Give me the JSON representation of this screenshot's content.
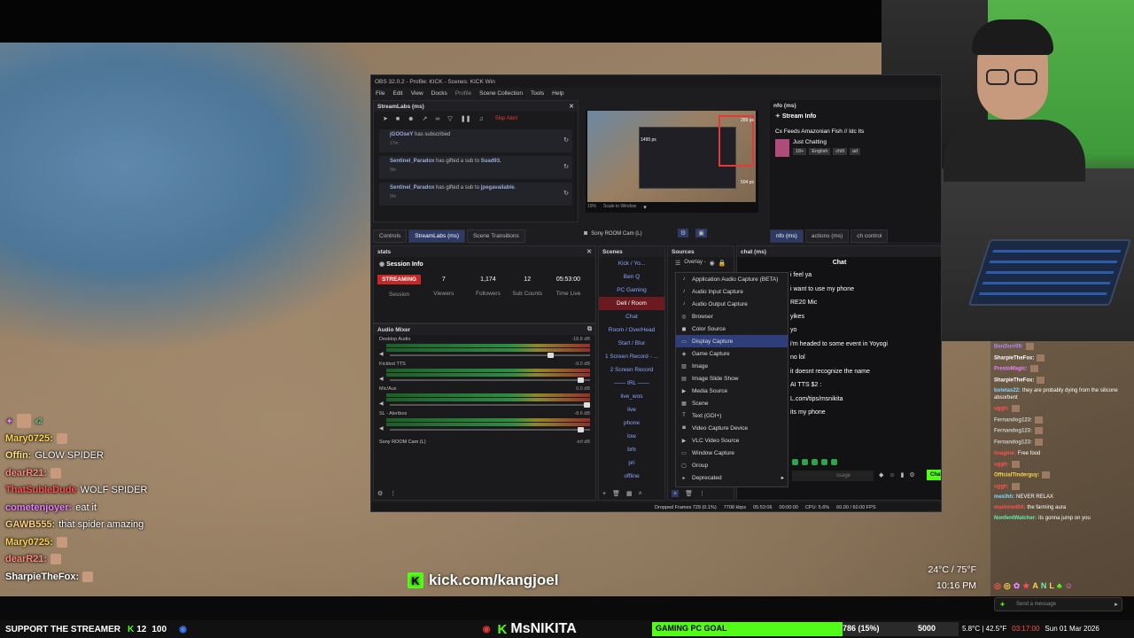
{
  "obs": {
    "title": "OBS 32.0.2 - Profile: KICK - Scenes: KICK Win",
    "menu": [
      "File",
      "Edit",
      "View",
      "Docks",
      "Profile",
      "Scene Collection",
      "Tools",
      "Help"
    ],
    "streamlabs_panel": {
      "title": "StreamLabs (ms)",
      "skip_alert": "Skip Alert",
      "alerts": [
        {
          "user": "jGOOseY",
          "text": "has subscribed",
          "time": "17m"
        },
        {
          "user": "Sentinel_Paradox",
          "text": "has gifted a sub to",
          "target": "Suad93.",
          "time": "5hr"
        },
        {
          "user": "Sentinel_Paradox",
          "text": "has gifted a sub to",
          "target": "jpegavailable.",
          "time": "5hr"
        }
      ]
    },
    "preview": {
      "zoom": "19%",
      "scale": "Scale to Window",
      "dim1": "1495 px",
      "dim2": "289 px",
      "dim3": "504 px"
    },
    "dock_tabs": [
      "Controls",
      "StreamLabs (ms)",
      "Scene Transitions"
    ],
    "source_cam": "Sony ROOM Cam (L)",
    "info_panel": {
      "title": "nfo (ms)",
      "stream_info": "Stream Info",
      "stream_title": "Cx Feeds Amazonian Fish // Idc Its",
      "category": "Just Chatting",
      "tags": [
        "18+",
        "English",
        "chill",
        "ad"
      ],
      "tabs": [
        "nfo (ms)",
        "actions (ms)",
        "ch control"
      ]
    },
    "stats": {
      "panel": "stats",
      "section": "Session Info",
      "status": "STREAMING",
      "session_label": "Session",
      "viewers": "7",
      "viewers_label": "Viewers",
      "followers": "1,174",
      "followers_label": "Followers",
      "subs": "12",
      "subs_label": "Sub Counts",
      "time": "05:53:00",
      "time_label": "Time Live"
    },
    "mixer": {
      "title": "Audio Mixer",
      "tracks": [
        {
          "name": "Desktop Audio",
          "db": "-18.8 dB",
          "fader": 0.82
        },
        {
          "name": "Kickbot TTS",
          "db": "-9.0 dB",
          "fader": 0.97
        },
        {
          "name": "Mic/Aux",
          "db": "0.0 dB",
          "fader": 1.0
        },
        {
          "name": "SL - Alertbox",
          "db": "-8.6 dB",
          "fader": 0.97
        }
      ],
      "last": "Sony ROOM Cam (L)",
      "last_db": "-inf dB",
      "scale": "-60 -55 -50 -45 -40 -35 -30 -25 -20 -15 -10 -5 0"
    },
    "scenes": {
      "title": "Scenes",
      "items": [
        "Kick / Yo...",
        "Ben Q",
        "PC Gaming",
        "Dell / Room",
        "Chat",
        "Room / OverHead",
        "Start / Blur",
        "1 Screen Record - ...",
        "2 Screen Record",
        "—— IRL ——",
        "live_wos",
        "live",
        "phone",
        "low",
        "brb",
        "pri",
        "offline"
      ],
      "active": "Dell / Room"
    },
    "sources": {
      "title": "Sources",
      "overlay": "Overlay -"
    },
    "add_menu": {
      "items": [
        "Application Audio Capture (BETA)",
        "Audio Input Capture",
        "Audio Output Capture",
        "Browser",
        "Color Source",
        "Display Capture",
        "Game Capture",
        "Image",
        "Image Slide Show",
        "Media Source",
        "Scene",
        "Text (GDI+)",
        "Video Capture Device",
        "VLC Video Source",
        "Window Capture",
        "Group",
        "Deprecated"
      ],
      "highlighted": "Display Capture"
    },
    "chat_dock": {
      "title": "chat (ms)",
      "header": "Chat",
      "lines": [
        "i feel ya",
        "i want to use my phone",
        "RE20 Mic",
        "yikes",
        "yo",
        "i'm headed to some event in Yoyogi",
        "no lol",
        "it doesnt recognize the name",
        "AI TTS $2 :",
        "L.com/tips/msnikita",
        "its my phone"
      ],
      "input_placeholder": "ssage",
      "send": "Chat"
    },
    "statusbar": {
      "dropped": "Dropped Frames 729 (0.1%)",
      "kbps": "7708 kbps",
      "time": "05:53:06",
      "rec": "00:00:00",
      "cpu": "CPU: 5.6%",
      "fps": "60.00 / 60.00 FPS"
    }
  },
  "overlay_chat": [
    {
      "user": "Mary0725:",
      "color": "#ffd54a",
      "msg": ""
    },
    {
      "user": "Offin:",
      "color": "#ffe082",
      "msg": "GLOW SPIDER"
    },
    {
      "user": "dearR21:",
      "color": "#ff8a80",
      "msg": ""
    },
    {
      "user": "ThatSubleDude",
      "color": "#ff5252",
      "msg": "WOLF SPIDER"
    },
    {
      "user": "cometenjoyer:",
      "color": "#ea80fc",
      "msg": "eat it"
    },
    {
      "user": "GAWB555:",
      "color": "#ffd180",
      "msg": "that spider amazing"
    },
    {
      "user": "Mary0725:",
      "color": "#ffd54a",
      "msg": ""
    },
    {
      "user": "dearR21:",
      "color": "#ff8a80",
      "msg": ""
    },
    {
      "user": "SharpieTheFox:",
      "color": "#ffffff",
      "msg": ""
    }
  ],
  "kick_link": "kick.com/kangjoel",
  "weather": {
    "temp": "24°C / 75°F",
    "time": "10:16 PM"
  },
  "right_chat": [
    {
      "user": "BenDurr69:",
      "color": "#b388ff",
      "msg": ""
    },
    {
      "user": "SharpieTheFox:",
      "color": "#ffffff",
      "msg": ""
    },
    {
      "user": "PrestoMagic:",
      "color": "#ea80fc",
      "msg": ""
    },
    {
      "user": "SharpieTheFox:",
      "color": "#ffffff",
      "msg": ""
    },
    {
      "user": "botetas22:",
      "color": "#80d8ff",
      "msg": "they are probably dying from the silicone absorbent"
    },
    {
      "user": "uggh:",
      "color": "#ff5252",
      "msg": ""
    },
    {
      "user": "Fernandog123:",
      "color": "#cccccc",
      "msg": ""
    },
    {
      "user": "Fernandog123:",
      "color": "#cccccc",
      "msg": ""
    },
    {
      "user": "Fernandog123:",
      "color": "#cccccc",
      "msg": ""
    },
    {
      "user": "Imagine:",
      "color": "#ff5252",
      "msg": "Free food"
    },
    {
      "user": "uggh:",
      "color": "#ff5252",
      "msg": ""
    },
    {
      "user": "OfficialTinderguy:",
      "color": "#ffd54a",
      "msg": ""
    },
    {
      "user": "uggh:",
      "color": "#ff5252",
      "msg": ""
    },
    {
      "user": "mexihh:",
      "color": "#80d8ff",
      "msg": "NEVER RELAX"
    },
    {
      "user": "markmed04:",
      "color": "#ff5252",
      "msg": "the farming aura"
    },
    {
      "user": "NonfentWatcher:",
      "color": "#69f0ae",
      "msg": "its gonna jump on you"
    }
  ],
  "send_message": "Send a message",
  "bottom": {
    "support": "SUPPORT THE STREAMER",
    "gifts": "12",
    "gifts_goal": "100",
    "channel": "MsNIKITA",
    "goal_label": "GAMING PC GOAL",
    "goal_progress": "786 (15%)",
    "goal_fraction": 0.15,
    "goal_target": "5000",
    "ticker": "5.8°C | 42.5°F",
    "clock": "03:17:00",
    "date": "Sun 01 Mar 2026"
  }
}
